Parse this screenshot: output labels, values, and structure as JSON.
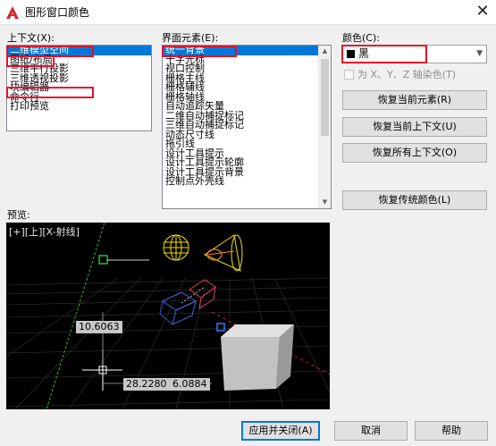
{
  "window": {
    "title": "图形窗口颜色",
    "close_glyph": "✕"
  },
  "context": {
    "label": "上下文(X):",
    "items": [
      "二维模型空间",
      "图纸/布局",
      "三维平行投影",
      "三维透视投影",
      "块编辑器",
      "命令行",
      "打印预览"
    ],
    "selected_index": 0
  },
  "interface": {
    "label": "界面元素(E):",
    "items": [
      "统一背景",
      "十字光标",
      "视口控制",
      "栅格主线",
      "栅格辅线",
      "栅格轴线",
      "自动追踪矢量",
      "二维自动捕捉标记",
      "三维自动捕捉标记",
      "动态尺寸线",
      "拖引线",
      "设计工具提示",
      "设计工具提示轮廓",
      "设计工具提示背景",
      "控制点外壳线"
    ],
    "selected_index": 0
  },
  "color": {
    "label": "颜色(C):",
    "value": "黑",
    "swatch_color": "#000000",
    "tint_label": "为 X、Y、Z 轴染色(T)",
    "tint_checked": false
  },
  "buttons": {
    "restore_element": "恢复当前元素(R)",
    "restore_context": "恢复当前上下文(U)",
    "restore_all": "恢复所有上下文(O)",
    "restore_classic": "恢复传统颜色(L)",
    "apply_close": "应用并关闭(A)",
    "cancel": "取消",
    "help": "帮助"
  },
  "preview": {
    "label": "预览:",
    "viewport_label": "[+][上][X-射线]",
    "dim_vertical": "10.6063",
    "dim_h1": "28.2280",
    "dim_h2": "6.0884"
  },
  "colors": {
    "selection": "#0078d7",
    "highlight_border": "#e8102a",
    "preview_bg": "#000000",
    "grid_line": "#3a3a3a",
    "axis_green": "#2fb82f",
    "axis_red": "#c03030",
    "light_yellow": "#f2e000",
    "spot_orange": "#f08020"
  }
}
